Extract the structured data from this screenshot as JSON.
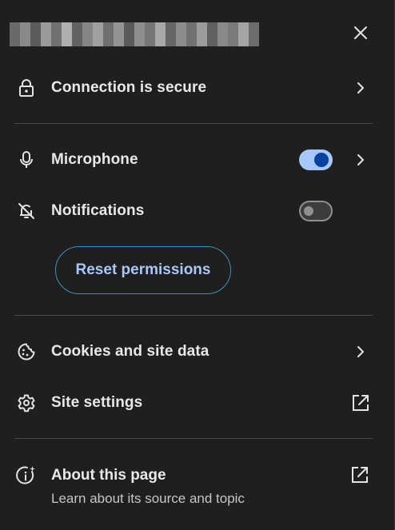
{
  "colors": {
    "background": "#1f1f1f",
    "text": "#e8e8e8",
    "subtext": "#c4c7c5",
    "accent": "#a8c7fa",
    "accent_dark": "#0842a0",
    "divider": "#474747",
    "button_border": "#3e8fb8"
  },
  "header": {
    "url_redacted": true,
    "close_icon": "close-icon"
  },
  "connection": {
    "label": "Connection is secure",
    "icon": "lock-icon",
    "trailing_icon": "chevron-right-icon"
  },
  "permissions": [
    {
      "label": "Microphone",
      "icon": "microphone-icon",
      "enabled": true,
      "trailing_icon": "chevron-right-icon"
    },
    {
      "label": "Notifications",
      "icon": "notifications-off-icon",
      "enabled": false
    }
  ],
  "reset_button": {
    "label": "Reset permissions"
  },
  "site_items": [
    {
      "label": "Cookies and site data",
      "icon": "cookie-icon",
      "trailing_icon": "chevron-right-icon"
    },
    {
      "label": "Site settings",
      "icon": "gear-icon",
      "trailing_icon": "external-link-icon"
    }
  ],
  "about": {
    "label": "About this page",
    "sublabel": "Learn about its source and topic",
    "icon": "info-sparkle-icon",
    "trailing_icon": "external-link-icon"
  }
}
